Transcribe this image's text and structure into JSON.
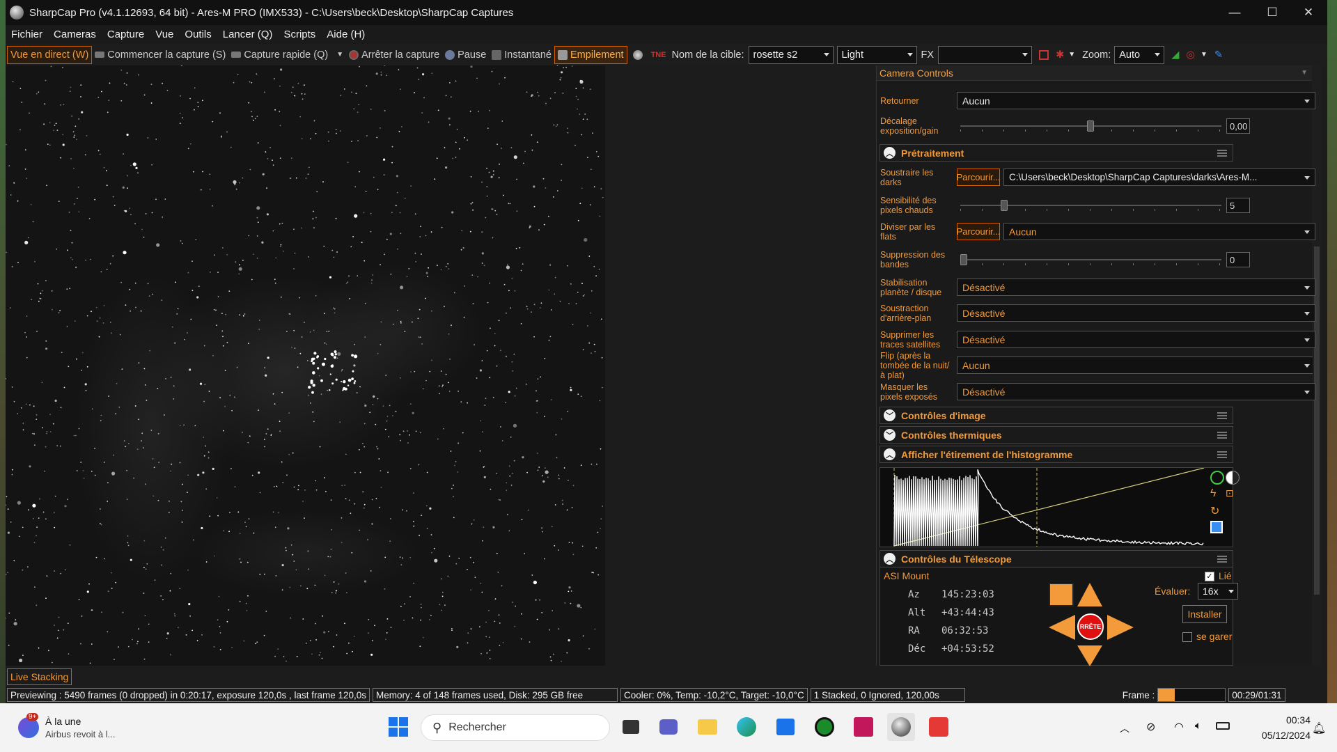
{
  "window": {
    "title": "SharpCap Pro (v4.1.12693, 64 bit) - Ares-M PRO (IMX533) - C:\\Users\\beck\\Desktop\\SharpCap Captures",
    "minimize": "—",
    "maximize": "☐",
    "close": "✕"
  },
  "menu": [
    "Fichier",
    "Cameras",
    "Capture",
    "Vue",
    "Outils",
    "Lancer (Q)",
    "Scripts",
    "Aide (H)"
  ],
  "toolbar": {
    "live_view": "Vue en direct (W)",
    "start_capture": "Commencer la capture (S)",
    "quick_capture": "Capture rapide (Q)",
    "stop_capture": "Arrêter la capture",
    "pause": "Pause",
    "snapshot": "Instantané",
    "stacking": "Empilement",
    "target_label": "Nom de la cible:",
    "target_value": "rosette s2",
    "frame_type": "Light",
    "fx_label": "FX",
    "fx_value": "",
    "zoom_label": "Zoom:",
    "zoom_value": "Auto"
  },
  "panel": {
    "title": "Camera Controls",
    "retourner_label": "Retourner",
    "retourner_value": "Aucun",
    "decalage_label": "Décalage exposition/gain",
    "decalage_value": "0,00",
    "pretraitement_title": "Prétraitement",
    "darks_label": "Soustraire les darks",
    "browse": "Parcourir...",
    "darks_value": "C:\\Users\\beck\\Desktop\\SharpCap Captures\\darks\\Ares-M...",
    "hotpix_label": "Sensibilité des pixels chauds",
    "hotpix_value": "5",
    "flats_label": "Diviser par les flats",
    "flats_value": "Aucun",
    "bandes_label": "Suppression des bandes",
    "bandes_value": "0",
    "stab_label": "Stabilisation planète / disque",
    "stab_value": "Désactivé",
    "bg_label": "Soustraction d'arrière-plan",
    "bg_value": "Désactivé",
    "sat_label": "Supprimer les traces satellites",
    "sat_value": "Désactivé",
    "flip_label": "Flip (après la tombée de la nuit/à plat)",
    "flip_value": "Aucun",
    "mask_label": "Masquer les pixels exposés",
    "mask_value": "Désactivé",
    "image_controls": "Contrôles d'image",
    "thermal_controls": "Contrôles thermiques",
    "histogram_title": "Afficher l'étirement de l'histogramme",
    "telescope_title": "Contrôles du Télescope",
    "mount_name": "ASI Mount",
    "linked_label": "Lié",
    "az_label": "Az",
    "az_value": "145:23:03",
    "alt_label": "Alt",
    "alt_value": "+43:44:43",
    "ra_label": "RA",
    "ra_value": "06:32:53",
    "dec_label": "Déc",
    "dec_value": "+04:53:52",
    "rate_label": "Évaluer:",
    "rate_value": "16x",
    "install_button": "Installer",
    "stop_button": "RRÊTE",
    "park_label": "se garer"
  },
  "live_stacking_tab": "Live Stacking",
  "status": {
    "preview": "Previewing : 5490 frames (0 dropped) in 0:20:17, exposure 120,0s , last frame 120,0s",
    "memory": "Memory: 4 of 148 frames used, Disk: 295 GB free",
    "cooler": "Cooler: 0%, Temp: -10,2°C, Target: -10,0°C",
    "stacked": "1 Stacked, 0 Ignored, 120,00s",
    "frame_label": "Frame :",
    "frame_progress": 0.25,
    "elapsed": "00:29/01:31"
  },
  "taskbar": {
    "news_badge": "9+",
    "news_title": "À la une",
    "news_sub": "Airbus revoit à l...",
    "search_placeholder": "Rechercher",
    "time": "00:34",
    "date": "05/12/2024"
  },
  "colors": {
    "accent": "#f39a3a",
    "dark_bg": "#1c1c1c"
  }
}
